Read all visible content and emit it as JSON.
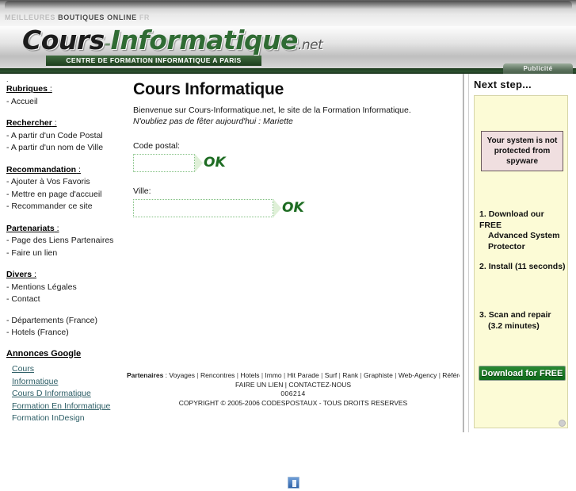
{
  "top_banner": {
    "segments": [
      {
        "text": "MEILLEURES ",
        "style": "grey"
      },
      {
        "text": "BOUTIQUES ONLINE",
        "style": "dark"
      },
      {
        "text": " FR",
        "style": "light"
      }
    ],
    "full_text": "MEILLEURES BOUTIQUES ONLINE FR"
  },
  "logo": {
    "part1": "Cours",
    "separator": "-",
    "part2": "Informatique",
    "tld": ".net",
    "tagline": "CENTRE DE FORMATION INFORMATIQUE A PARIS",
    "advert_tab": "Publicité",
    "colors": {
      "green": "#2f6b33",
      "dark": "#1c1c1c",
      "band": "#2d5230"
    }
  },
  "sidebar": {
    "leading_dot": ".",
    "sections": [
      {
        "heading": "Rubriques",
        "heading_suffix": " :",
        "items": [
          "- Accueil"
        ]
      },
      {
        "heading": "Rechercher",
        "heading_suffix": " :",
        "items": [
          "- A partir d'un Code Postal",
          "- A partir d'un nom de Ville"
        ]
      },
      {
        "heading": "Recommandation",
        "heading_suffix": " :",
        "items": [
          "- Ajouter à Vos Favoris",
          "- Mettre en page d'accueil",
          "- Recommander ce site"
        ]
      },
      {
        "heading": "Partenariats",
        "heading_suffix": " :",
        "items": [
          "- Page des Liens Partenaires",
          "- Faire un lien"
        ]
      },
      {
        "heading": "Divers",
        "heading_suffix": " :",
        "items": [
          "- Mentions Légales",
          "- Contact"
        ]
      },
      {
        "heading": "",
        "heading_suffix": "",
        "items": [
          "- Départements (France)",
          "- Hotels (France)"
        ]
      }
    ],
    "ads": {
      "heading": "Annonces Google",
      "links": [
        {
          "label": "Cours",
          "underlined": true
        },
        {
          "label": "Informatique",
          "underlined": true
        },
        {
          "label": "Cours D Informatique",
          "underlined": true
        },
        {
          "label": "Formation En Informatique",
          "underlined": true
        },
        {
          "label": "Formation InDesign",
          "underlined": false
        }
      ],
      "link_color": "#2d5e66"
    }
  },
  "main": {
    "title": "Cours Informatique",
    "welcome": "Bienvenue sur Cours-Informatique.net, le site de la Formation Informatique.",
    "fete": "N'oubliez pas de fêter aujourd'hui : Mariette",
    "form": {
      "postal": {
        "label": "Code postal:",
        "value": "",
        "placeholder": "",
        "button_label": "OK"
      },
      "city": {
        "label": "Ville:",
        "value": "",
        "placeholder": "",
        "button_label": "OK"
      }
    }
  },
  "footer": {
    "partners_label": "Partenaires",
    "partners_separator": " : ",
    "partners": [
      "Voyages",
      "Rencontres",
      "Hotels",
      "Immo",
      "Hit Parade",
      "Surf",
      "Rank",
      "Graphiste",
      "Web-Agency",
      "Référencement"
    ],
    "links_line": "FAIRE UN LIEN | CONTACTEZ-NOUS",
    "counter": "006214",
    "copyright": "COPYRIGHT © 2005-2006 CODESPOSTAUX - TOUS DROITS RESERVES",
    "badge_icon": "floppy-disk-icon"
  },
  "right_panel": {
    "title": "Next step...",
    "warning": "Your system is not protected from spyware",
    "steps": [
      {
        "number": "1.",
        "line1": "Download our FREE",
        "line2": "Advanced System",
        "line3": "Protector"
      },
      {
        "number": "2.",
        "line1": "Install (11 seconds)",
        "line2": "",
        "line3": ""
      },
      {
        "number": "3.",
        "line1": "Scan and repair",
        "line2": "(3.2 minutes)",
        "line3": ""
      }
    ],
    "download_button": "Download for FREE",
    "colors": {
      "panel_bg": "#fcfbd6",
      "warning_bg": "#f0dfe0",
      "button": "#1a7a24"
    }
  }
}
